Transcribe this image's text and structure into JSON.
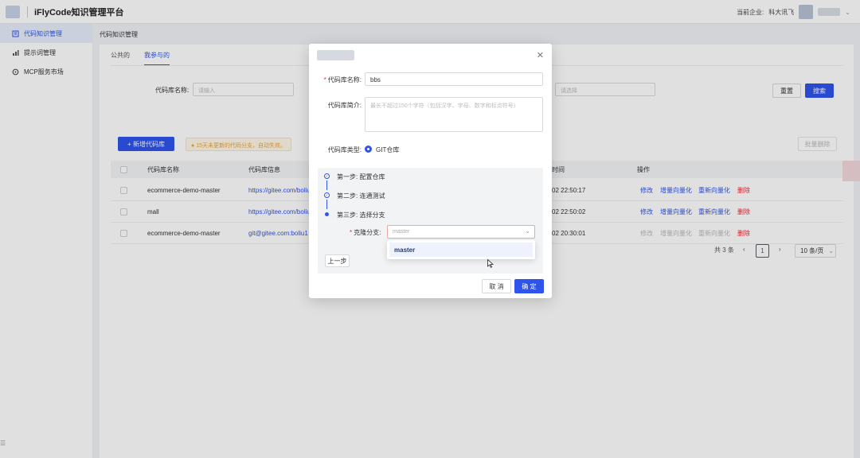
{
  "header": {
    "app_title": "iFlyCode知识管理平台",
    "company_label": "当前企业:",
    "company_name": "科大讯飞"
  },
  "sidebar": {
    "items": [
      {
        "label": "代码知识管理",
        "icon": "code-icon"
      },
      {
        "label": "提示词管理",
        "icon": "chart-icon"
      },
      {
        "label": "MCP服务市场",
        "icon": "settings-icon"
      }
    ]
  },
  "breadcrumb": "代码知识管理",
  "tabs": [
    "公共的",
    "我参与的"
  ],
  "filters": {
    "name_label": "代码库名称:",
    "name_placeholder": "请输入",
    "select_placeholder": "请选择"
  },
  "buttons": {
    "reset": "重置",
    "search": "搜索",
    "add": "+ 新增代码库",
    "batch_delete": "批量删除"
  },
  "tip": "15天未更新的代码分支，自动失效。",
  "table": {
    "headers": [
      "代码库名称",
      "代码库信息",
      "时间",
      "操作"
    ],
    "rows": [
      {
        "name": "ecommerce-demo-master",
        "info": "https://gitee.com/boliu",
        "time": "02 22:50:17"
      },
      {
        "name": "mall",
        "info": "https://gitee.com/boliu",
        "time": "02 22:50:02"
      },
      {
        "name": "ecommerce-demo-master",
        "info": "git@gitee.com:boliu1",
        "time": "02 20:30:01"
      }
    ],
    "actions": [
      "修改",
      "增量向量化",
      "重新向量化",
      "删除"
    ]
  },
  "pagination": {
    "total": "共 3 条",
    "current": "1",
    "page_size": "10 条/页"
  },
  "modal": {
    "name_label": "代码库名称:",
    "name_value": "bbs",
    "desc_label": "代码库简介:",
    "desc_placeholder": "最长不超过150个字符（包括汉字、字母、数字和标点符号）",
    "type_label": "代码库类型:",
    "type_value": "GIT仓库",
    "steps": [
      "第一步: 配置仓库",
      "第二步: 连通测试",
      "第三步: 选择分支"
    ],
    "branch_label": "克隆分支:",
    "branch_placeholder": "master",
    "dropdown_option": "master",
    "prev_button": "上一步",
    "cancel_button": "取 消",
    "ok_button": "确 定"
  }
}
